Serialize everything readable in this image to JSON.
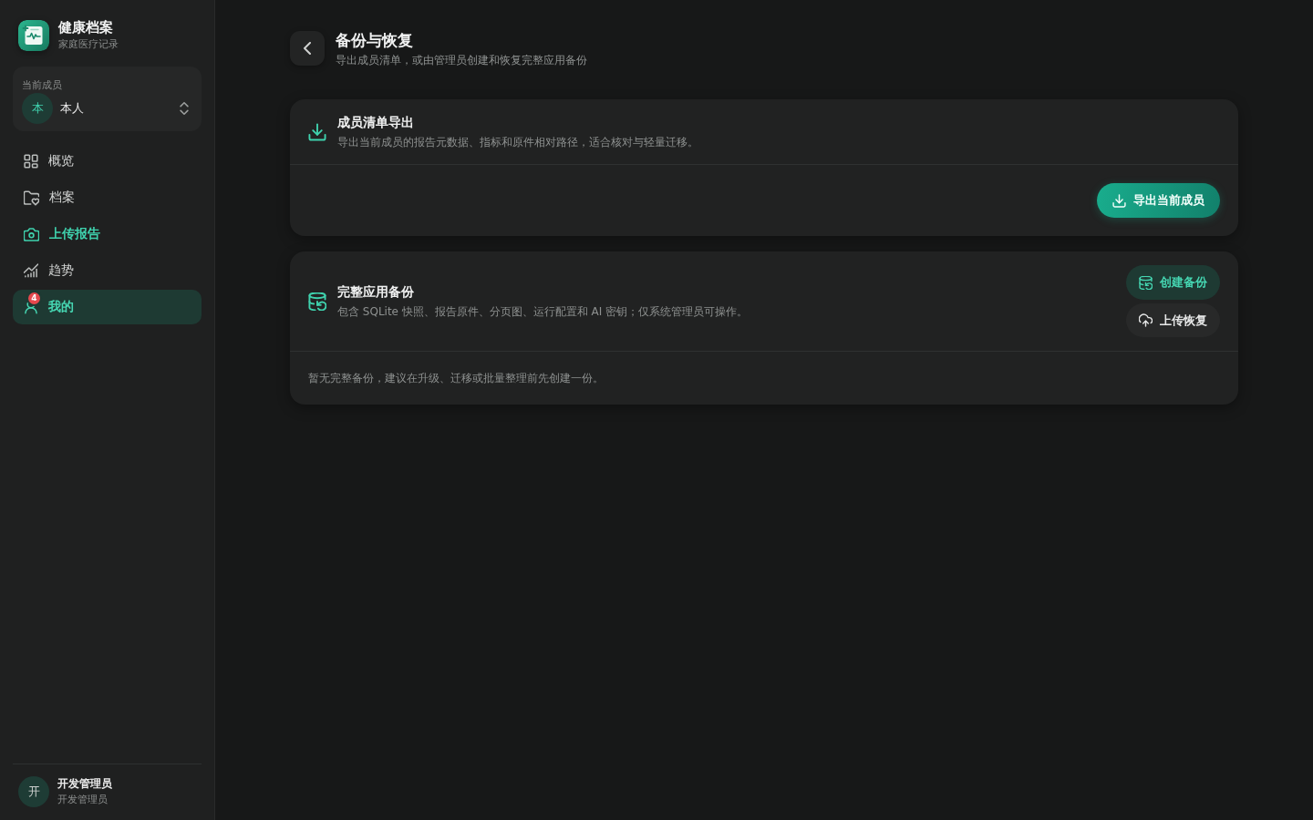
{
  "sidebar": {
    "app": {
      "title": "健康档案",
      "subtitle": "家庭医疗记录"
    },
    "member_switcher": {
      "label": "当前成员",
      "avatar": "本",
      "name": "本人"
    },
    "nav": [
      {
        "label": "概览",
        "selected": false,
        "accent": false
      },
      {
        "label": "档案",
        "selected": false,
        "accent": false
      },
      {
        "label": "上传报告",
        "selected": false,
        "accent": true
      },
      {
        "label": "趋势",
        "selected": false,
        "accent": false
      },
      {
        "label": "我的",
        "selected": true,
        "accent": false,
        "badge": "4"
      }
    ],
    "user": {
      "avatar": "开",
      "name": "开发管理员",
      "role": "开发管理员"
    }
  },
  "page": {
    "title": "备份与恢复",
    "subtitle": "导出成员清单，或由管理员创建和恢复完整应用备份"
  },
  "cards": [
    {
      "kind": "export",
      "title": "成员清单导出",
      "description": "导出当前成员的报告元数据、指标和原件相对路径，适合核对与轻量迁移。",
      "footer_actions": [
        {
          "label": "导出当前成员",
          "kind": "primary"
        }
      ]
    },
    {
      "kind": "backup",
      "title": "完整应用备份",
      "description": "包含 SQLite 快照、报告原件、分页图、运行配置和 AI 密钥；仅系统管理员可操作。",
      "header_actions": [
        {
          "label": "创建备份",
          "kind": "soft"
        },
        {
          "label": "上传恢复",
          "kind": "neutral"
        }
      ],
      "footer_note": "暂无完整备份，建议在升级、迁移或批量整理前先创建一份。"
    }
  ]
}
